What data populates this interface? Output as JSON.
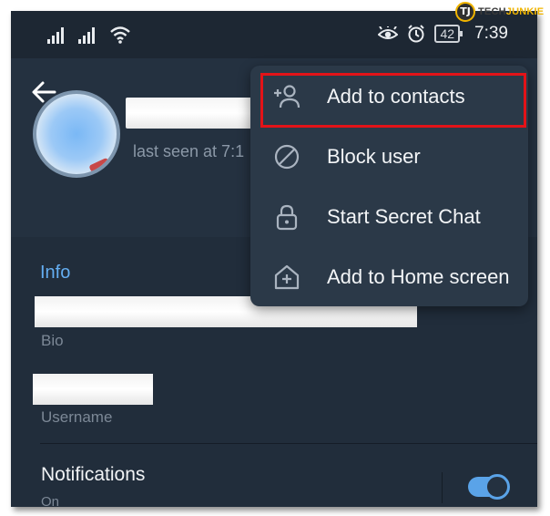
{
  "status_bar": {
    "battery_level": "42",
    "time": "7:39",
    "icons": [
      "signal-icon",
      "signal-icon",
      "wifi-icon",
      "eye-icon",
      "alarm-icon",
      "battery-icon"
    ]
  },
  "profile": {
    "last_seen": "last seen at 7:1"
  },
  "menu": {
    "items": [
      {
        "label": "Add to contacts",
        "icon": "add-contact-icon",
        "highlighted": true
      },
      {
        "label": "Block user",
        "icon": "block-icon"
      },
      {
        "label": "Start Secret Chat",
        "icon": "lock-icon"
      },
      {
        "label": "Add to Home screen",
        "icon": "home-add-icon"
      }
    ]
  },
  "info": {
    "title": "Info",
    "bio_label": "Bio",
    "username_label": "Username"
  },
  "notifications": {
    "title": "Notifications",
    "status": "On",
    "enabled": true
  },
  "watermark": {
    "logo_letters": "TJ",
    "brand_part1": "TECH",
    "brand_part2": "JUNKIE"
  },
  "colors": {
    "background": "#212d3b",
    "accent": "#64aef2",
    "highlight_border": "#e31318",
    "menu_bg": "#2b3948"
  }
}
